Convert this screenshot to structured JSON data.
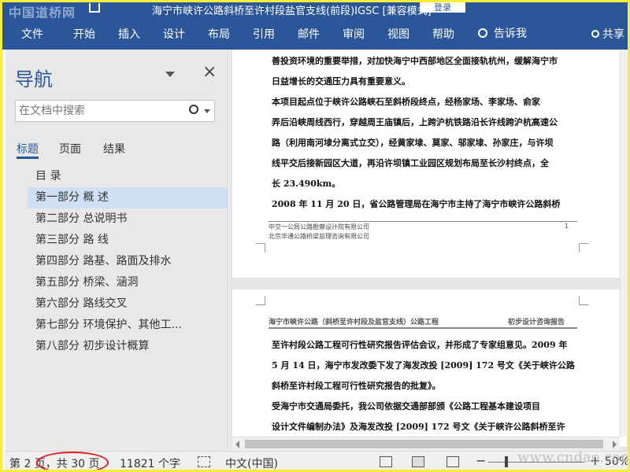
{
  "title_bar": {
    "watermark": "中国道桥网",
    "title": "海宁市峡许公路斜桥至许村段盐官支线(前段)IGSC [兼容模式]",
    "login_label": "登录"
  },
  "ribbon": {
    "tabs": [
      "文件",
      "开始",
      "插入",
      "设计",
      "布局",
      "引用",
      "邮件",
      "审阅",
      "视图",
      "帮助"
    ],
    "tell_me": "告诉我",
    "share": "共享"
  },
  "navigation": {
    "title": "导航",
    "search_placeholder": "在文档中搜索",
    "tabs": [
      "标题",
      "页面",
      "结果"
    ],
    "headings": [
      {
        "label": "目  录",
        "selected": false
      },
      {
        "label": "第一部分  概  述",
        "selected": true
      },
      {
        "label": "第二部分  总说明书",
        "selected": false
      },
      {
        "label": "第三部分    路   线",
        "selected": false
      },
      {
        "label": "第四部分 路基、路面及排水",
        "selected": false
      },
      {
        "label": "第五部分 桥梁、涵洞",
        "selected": false
      },
      {
        "label": "第六部分 路线交叉",
        "selected": false
      },
      {
        "label": "第七部分 环境保护、其他工...",
        "selected": false
      },
      {
        "label": "第八部分  初步设计概算",
        "selected": false
      }
    ]
  },
  "document": {
    "page1": {
      "lines": [
        "善投资环境的重要举措，对加快海宁中西部地区全面接轨杭州，缓解海宁市",
        "日益增长的交通压力具有重要意义。",
        "    本项目起点位于峡许公路峡石至斜桥段终点，经杨家场、李家场、俞家",
        "弄后沿峡周线西行，穿越周王庙镇后，上跨沪杭铁路沿长许线跨沪杭高速公",
        "路（利用南河埭分离式立交），经黄家埭、莫家、邬家埭、孙家庄，与许坝",
        "线平交后接新园区大道，再沿许坝镇工业园区规划布局至长沙村终点，全",
        "长 23.490km。",
        "    2008 年 11 月 20 日，省公路管理局在海宁市主持了海宁市峡许公路斜桥"
      ],
      "footer_line1": "中交一公局公路勘察设计院有限公司",
      "footer_line2": "北京华通公路桥梁监理咨询有限公司",
      "page_number": "1"
    },
    "page2": {
      "header_left": "海宁市峡许公路（斜桥至许村段及盐官支线）公路工程",
      "header_right": "初步设计咨询报告",
      "lines": [
        "至许村段公路工程可行性研究报告评估会议，并形成了专家组意见。2009 年",
        "5 月 14 日，海宁市发改委下发了海发改投 [2009] 172 号文《关于峡许公路",
        "斜桥至许村段工程可行性研究报告的批复》。",
        "    受海宁市交通局委托，我公司依据交通部部颁《公路工程基本建设项目",
        "设计文件编制办法》及海发改投 [2009] 172 号文《关于峡许公路斜桥至许"
      ]
    }
  },
  "status_bar": {
    "page_info": "第 2 页，共 30 页",
    "word_count": "11821 个字",
    "language": "中文(中国)",
    "zoom": "50%",
    "watermark": "www.cndao.com",
    "highlight_color": "#e21d1d"
  },
  "colors": {
    "ribbon": "#2b579a",
    "frame": "#f6ee3a",
    "selected_heading": "#cfe0f5"
  }
}
